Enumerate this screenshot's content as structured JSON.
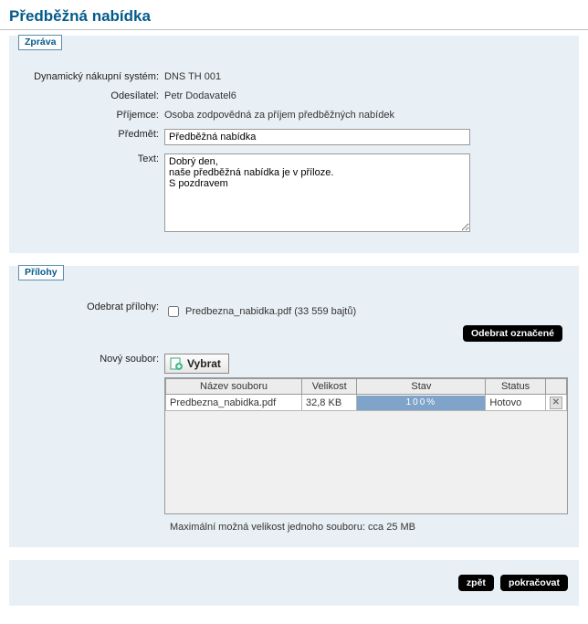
{
  "page": {
    "title": "Předběžná nabídka"
  },
  "message_section": {
    "header": "Zpráva",
    "rows": {
      "dns_label": "Dynamický nákupní systém:",
      "dns_value": "DNS TH 001",
      "sender_label": "Odesílatel:",
      "sender_value": "Petr Dodavatel6",
      "recipient_label": "Příjemce:",
      "recipient_value": "Osoba zodpovědná za příjem předběžných nabídek",
      "subject_label": "Předmět:",
      "subject_value": "Předběžná nabídka",
      "text_label": "Text:",
      "text_value": "Dobrý den,\nnaše předběžná nabídka je v příloze.\nS pozdravem"
    }
  },
  "attachments_section": {
    "header": "Přílohy",
    "remove_label": "Odebrat přílohy:",
    "attachment_text": "Predbezna_nabidka.pdf (33 559 bajtů)",
    "remove_btn": "Odebrat označené",
    "newfile_label": "Nový soubor:",
    "choose_btn": "Vybrat",
    "table": {
      "col_name": "Název souboru",
      "col_size": "Velikost",
      "col_state": "Stav",
      "col_status": "Status",
      "rows": [
        {
          "name": "Predbezna_nabidka.pdf",
          "size": "32,8 KB",
          "progress": "100%",
          "status": "Hotovo"
        }
      ]
    },
    "max_note": "Maximální možná velikost jednoho souboru: cca 25 MB"
  },
  "footer": {
    "back": "zpět",
    "continue": "pokračovat"
  }
}
